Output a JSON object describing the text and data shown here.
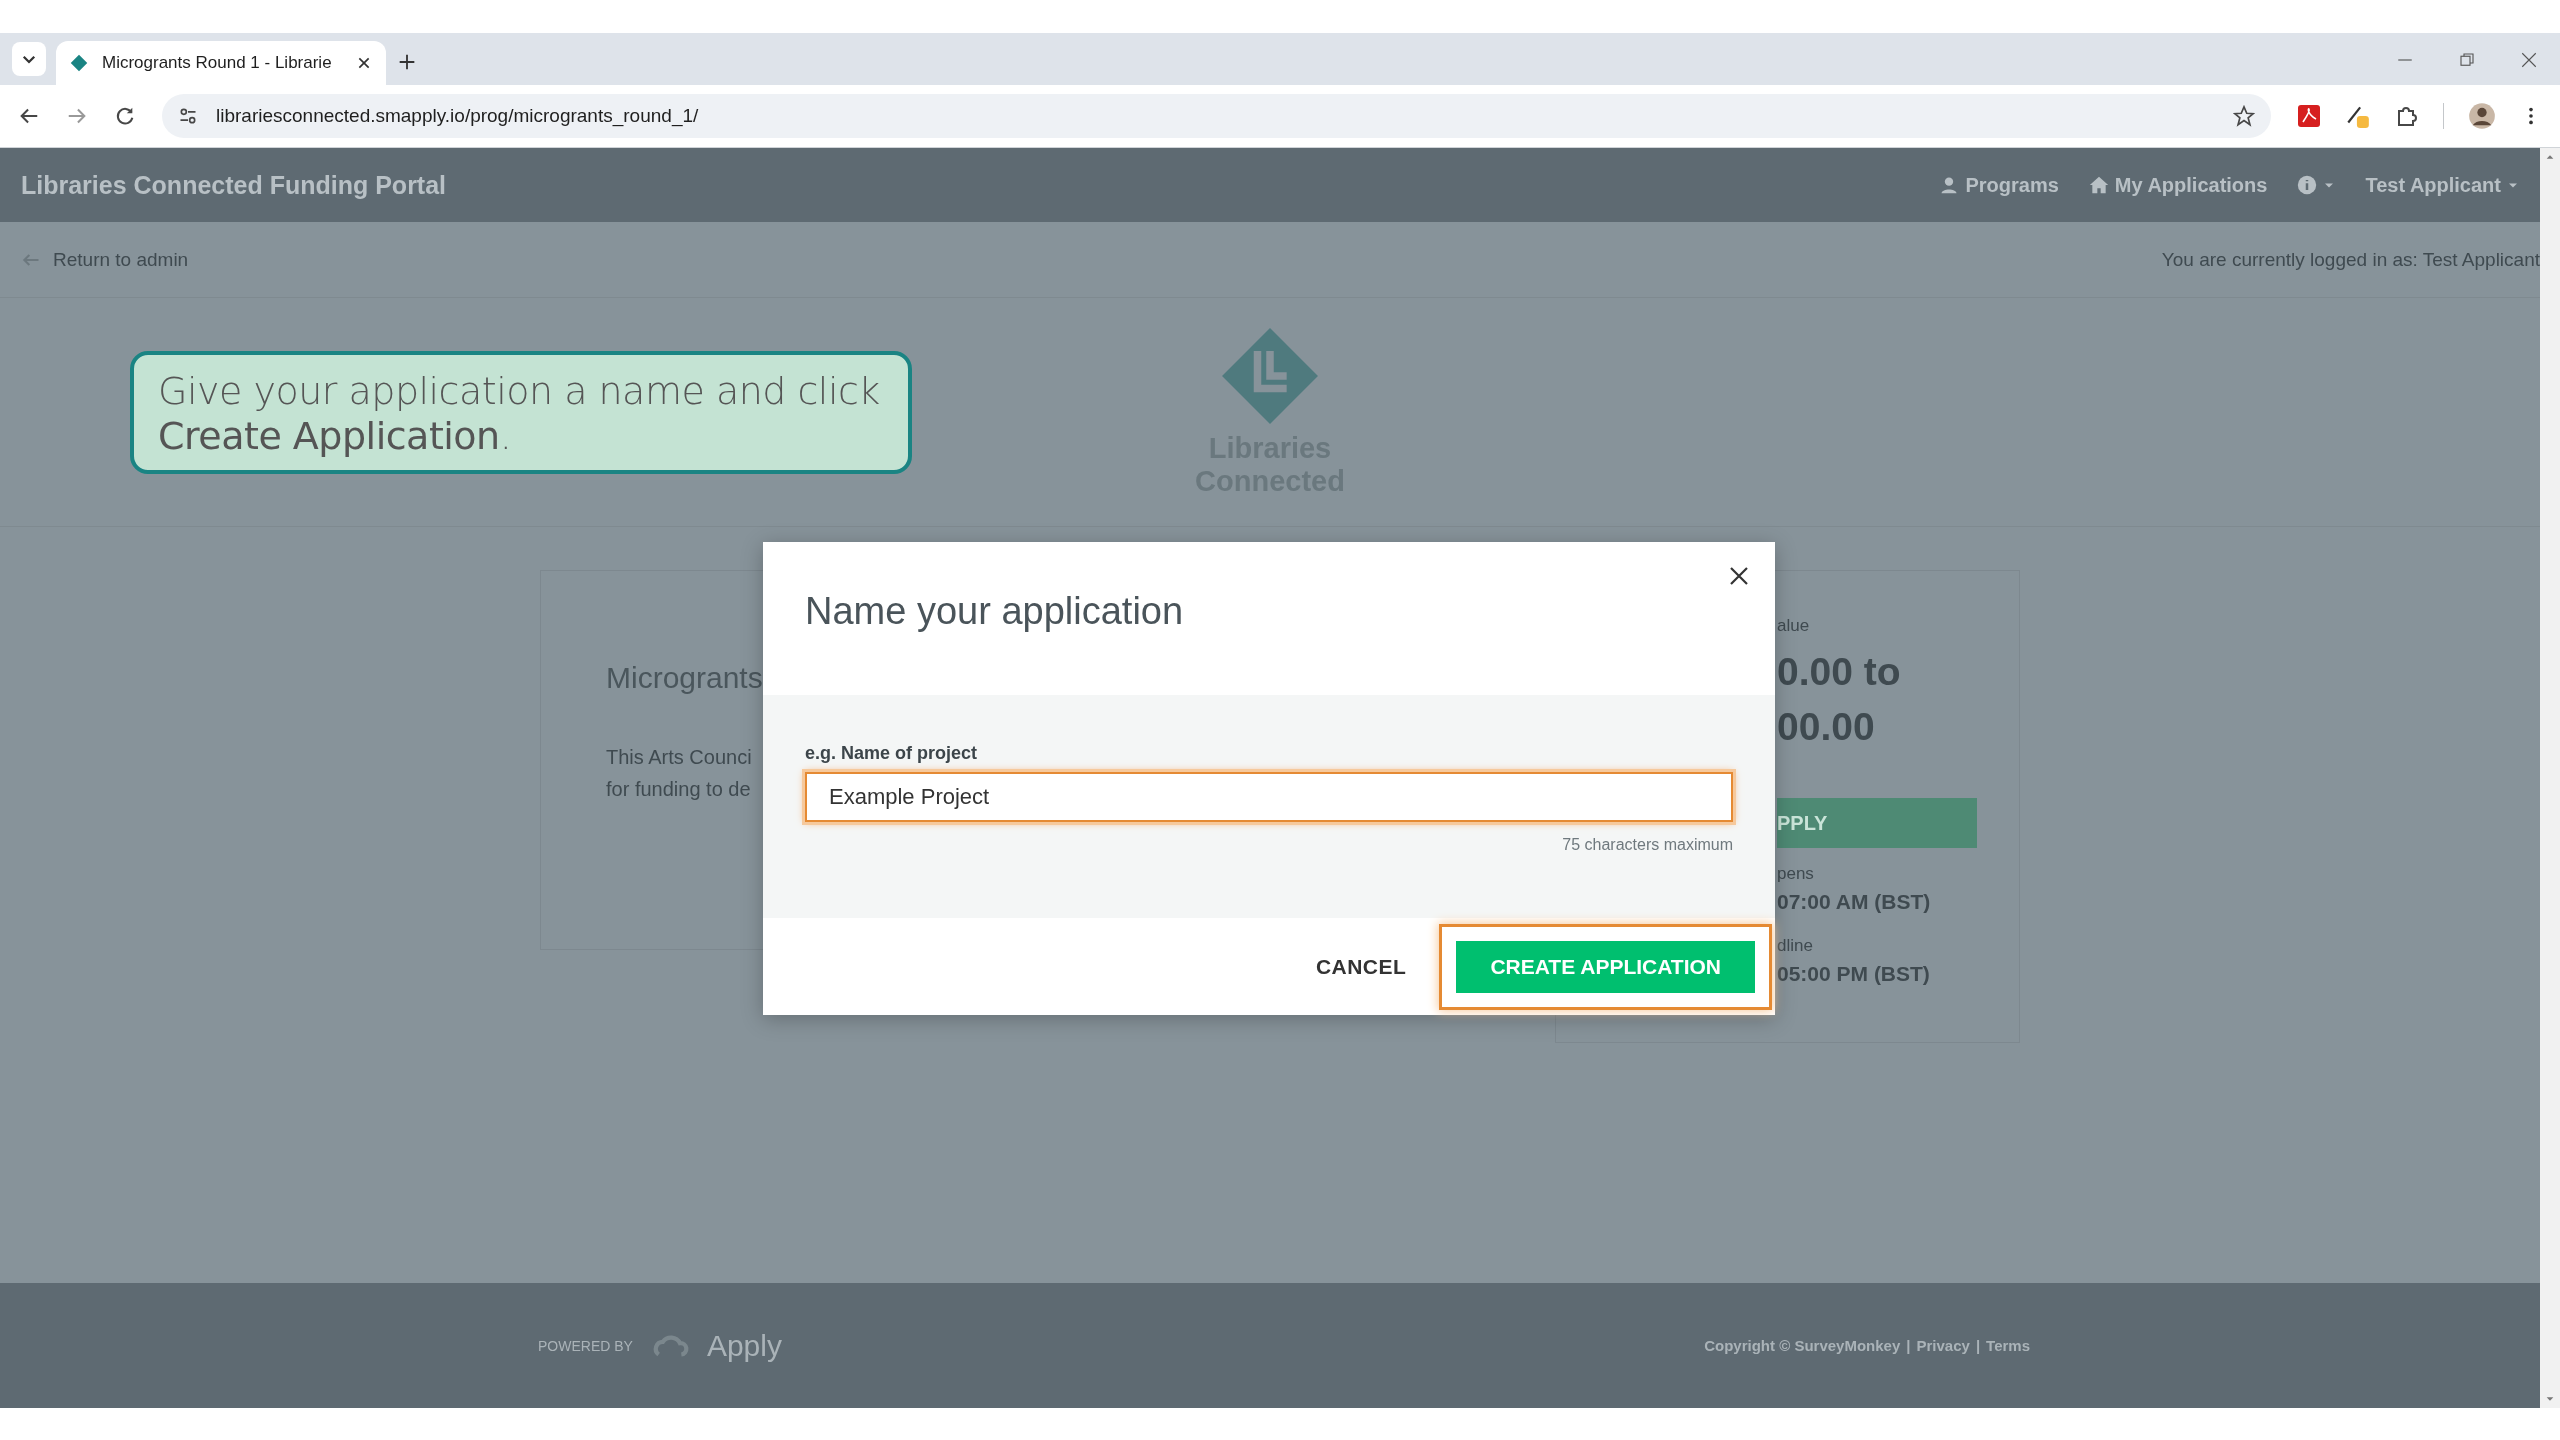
{
  "browser": {
    "tabs": [
      {
        "title": "Microgrants Round 1 - Librarie",
        "selected": true
      }
    ],
    "url": "librariesconnected.smapply.io/prog/microgrants_round_1/"
  },
  "header": {
    "title": "Libraries Connected Funding Portal",
    "nav": [
      {
        "label": "Programs",
        "kind": "person"
      },
      {
        "label": "My Applications",
        "kind": "home"
      }
    ],
    "user": "Test Applicant"
  },
  "subheader": {
    "return_link": "Return to admin",
    "logged_in": "You are currently logged in as: Test Applicant"
  },
  "callout": {
    "text": "Give your application a name and click **Create Application**."
  },
  "logo": {
    "lines": [
      "Libraries",
      "Connected"
    ]
  },
  "program_card": {
    "title": "Microgrants",
    "description_lines": [
      "This Arts Counci",
      "for funding to de"
    ]
  },
  "award_card": {
    "value_label": "alue",
    "amount_lines": [
      "0.00 to",
      "00.00"
    ],
    "apply_button": "PPLY",
    "opens_label": "pens",
    "opens_time": "07:00 AM (BST)",
    "deadline_label": "dline",
    "deadline_time": "05:00 PM (BST)"
  },
  "modal": {
    "title": "Name your application",
    "field_label": "e.g. Name of project",
    "value": "Example Project",
    "hint": "75 characters maximum",
    "cancel": "CANCEL",
    "create": "CREATE APPLICATION"
  },
  "footer": {
    "powered_by": "POWERED BY",
    "brand": "Apply",
    "legal": [
      "Copyright © SurveyMonkey",
      "|",
      "Privacy",
      "|",
      "Terms"
    ]
  }
}
